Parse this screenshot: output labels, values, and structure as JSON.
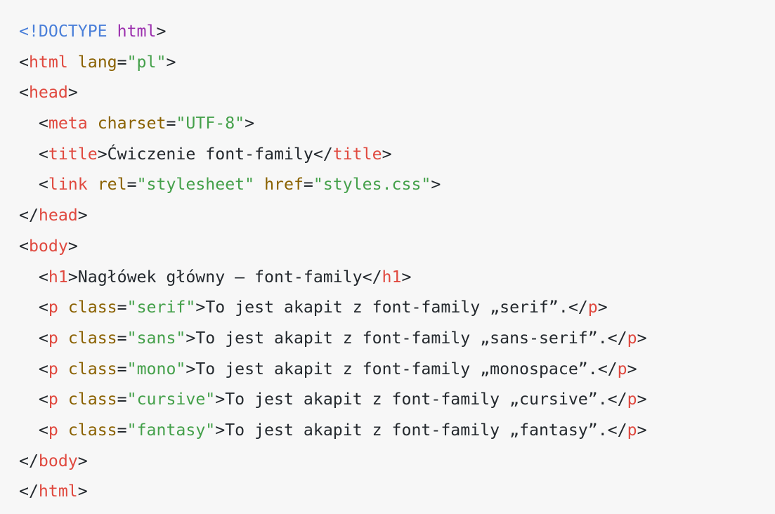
{
  "code_lines": [
    [
      {
        "t": "<!DOCTYPE",
        "c": "doctype"
      },
      {
        "t": " ",
        "c": "text"
      },
      {
        "t": "html",
        "c": "kw"
      },
      {
        "t": ">",
        "c": "punct"
      }
    ],
    [
      {
        "t": "<",
        "c": "punct"
      },
      {
        "t": "html",
        "c": "tag"
      },
      {
        "t": " ",
        "c": "text"
      },
      {
        "t": "lang",
        "c": "attr"
      },
      {
        "t": "=",
        "c": "punct"
      },
      {
        "t": "\"pl\"",
        "c": "str"
      },
      {
        "t": ">",
        "c": "punct"
      }
    ],
    [
      {
        "t": "<",
        "c": "punct"
      },
      {
        "t": "head",
        "c": "tag"
      },
      {
        "t": ">",
        "c": "punct"
      }
    ],
    [
      {
        "t": "  <",
        "c": "punct"
      },
      {
        "t": "meta",
        "c": "tag"
      },
      {
        "t": " ",
        "c": "text"
      },
      {
        "t": "charset",
        "c": "attr"
      },
      {
        "t": "=",
        "c": "punct"
      },
      {
        "t": "\"UTF-8\"",
        "c": "str"
      },
      {
        "t": ">",
        "c": "punct"
      }
    ],
    [
      {
        "t": "  <",
        "c": "punct"
      },
      {
        "t": "title",
        "c": "tag"
      },
      {
        "t": ">",
        "c": "punct"
      },
      {
        "t": "Ćwiczenie font-family",
        "c": "text"
      },
      {
        "t": "</",
        "c": "punct"
      },
      {
        "t": "title",
        "c": "tag"
      },
      {
        "t": ">",
        "c": "punct"
      }
    ],
    [
      {
        "t": "  <",
        "c": "punct"
      },
      {
        "t": "link",
        "c": "tag"
      },
      {
        "t": " ",
        "c": "text"
      },
      {
        "t": "rel",
        "c": "attr"
      },
      {
        "t": "=",
        "c": "punct"
      },
      {
        "t": "\"stylesheet\"",
        "c": "str"
      },
      {
        "t": " ",
        "c": "text"
      },
      {
        "t": "href",
        "c": "attr"
      },
      {
        "t": "=",
        "c": "punct"
      },
      {
        "t": "\"styles.css\"",
        "c": "str"
      },
      {
        "t": ">",
        "c": "punct"
      }
    ],
    [
      {
        "t": "</",
        "c": "punct"
      },
      {
        "t": "head",
        "c": "tag"
      },
      {
        "t": ">",
        "c": "punct"
      }
    ],
    [
      {
        "t": "<",
        "c": "punct"
      },
      {
        "t": "body",
        "c": "tag"
      },
      {
        "t": ">",
        "c": "punct"
      }
    ],
    [
      {
        "t": "  <",
        "c": "punct"
      },
      {
        "t": "h1",
        "c": "tag"
      },
      {
        "t": ">",
        "c": "punct"
      },
      {
        "t": "Nagłówek główny – font-family",
        "c": "text"
      },
      {
        "t": "</",
        "c": "punct"
      },
      {
        "t": "h1",
        "c": "tag"
      },
      {
        "t": ">",
        "c": "punct"
      }
    ],
    [
      {
        "t": "  <",
        "c": "punct"
      },
      {
        "t": "p",
        "c": "tag"
      },
      {
        "t": " ",
        "c": "text"
      },
      {
        "t": "class",
        "c": "attr"
      },
      {
        "t": "=",
        "c": "punct"
      },
      {
        "t": "\"serif\"",
        "c": "str"
      },
      {
        "t": ">",
        "c": "punct"
      },
      {
        "t": "To jest akapit z font-family „serif”.",
        "c": "text"
      },
      {
        "t": "</",
        "c": "punct"
      },
      {
        "t": "p",
        "c": "tag"
      },
      {
        "t": ">",
        "c": "punct"
      }
    ],
    [
      {
        "t": "  <",
        "c": "punct"
      },
      {
        "t": "p",
        "c": "tag"
      },
      {
        "t": " ",
        "c": "text"
      },
      {
        "t": "class",
        "c": "attr"
      },
      {
        "t": "=",
        "c": "punct"
      },
      {
        "t": "\"sans\"",
        "c": "str"
      },
      {
        "t": ">",
        "c": "punct"
      },
      {
        "t": "To jest akapit z font-family „sans-serif”.",
        "c": "text"
      },
      {
        "t": "</",
        "c": "punct"
      },
      {
        "t": "p",
        "c": "tag"
      },
      {
        "t": ">",
        "c": "punct"
      }
    ],
    [
      {
        "t": "  <",
        "c": "punct"
      },
      {
        "t": "p",
        "c": "tag"
      },
      {
        "t": " ",
        "c": "text"
      },
      {
        "t": "class",
        "c": "attr"
      },
      {
        "t": "=",
        "c": "punct"
      },
      {
        "t": "\"mono\"",
        "c": "str"
      },
      {
        "t": ">",
        "c": "punct"
      },
      {
        "t": "To jest akapit z font-family „monospace”.",
        "c": "text"
      },
      {
        "t": "</",
        "c": "punct"
      },
      {
        "t": "p",
        "c": "tag"
      },
      {
        "t": ">",
        "c": "punct"
      }
    ],
    [
      {
        "t": "  <",
        "c": "punct"
      },
      {
        "t": "p",
        "c": "tag"
      },
      {
        "t": " ",
        "c": "text"
      },
      {
        "t": "class",
        "c": "attr"
      },
      {
        "t": "=",
        "c": "punct"
      },
      {
        "t": "\"cursive\"",
        "c": "str"
      },
      {
        "t": ">",
        "c": "punct"
      },
      {
        "t": "To jest akapit z font-family „cursive”.",
        "c": "text"
      },
      {
        "t": "</",
        "c": "punct"
      },
      {
        "t": "p",
        "c": "tag"
      },
      {
        "t": ">",
        "c": "punct"
      }
    ],
    [
      {
        "t": "  <",
        "c": "punct"
      },
      {
        "t": "p",
        "c": "tag"
      },
      {
        "t": " ",
        "c": "text"
      },
      {
        "t": "class",
        "c": "attr"
      },
      {
        "t": "=",
        "c": "punct"
      },
      {
        "t": "\"fantasy\"",
        "c": "str"
      },
      {
        "t": ">",
        "c": "punct"
      },
      {
        "t": "To jest akapit z font-family „fantasy”.",
        "c": "text"
      },
      {
        "t": "</",
        "c": "punct"
      },
      {
        "t": "p",
        "c": "tag"
      },
      {
        "t": ">",
        "c": "punct"
      }
    ],
    [
      {
        "t": "</",
        "c": "punct"
      },
      {
        "t": "body",
        "c": "tag"
      },
      {
        "t": ">",
        "c": "punct"
      }
    ],
    [
      {
        "t": "</",
        "c": "punct"
      },
      {
        "t": "html",
        "c": "tag"
      },
      {
        "t": ">",
        "c": "punct"
      }
    ]
  ],
  "colors": {
    "background": "#f7f7f7",
    "doctype": "#4a7fd9",
    "keyword": "#9b2fae",
    "tag": "#e0493f",
    "attribute": "#8a6100",
    "string": "#44a04a",
    "text": "#24292e"
  }
}
